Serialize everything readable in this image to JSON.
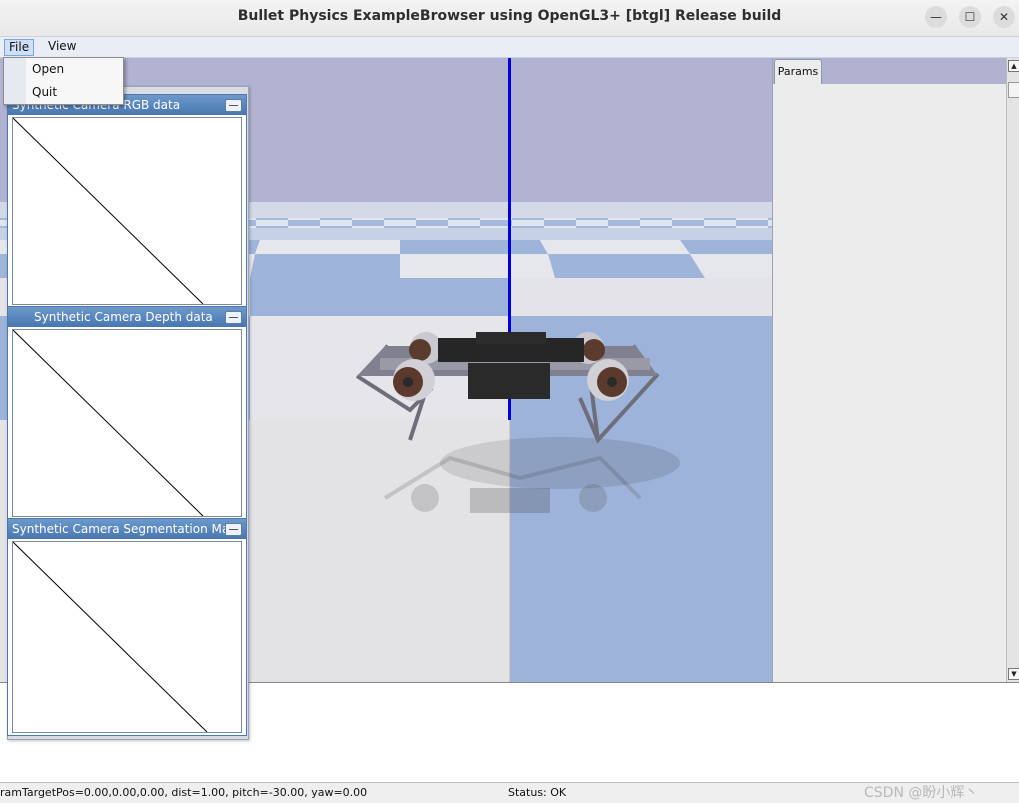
{
  "window": {
    "title": "Bullet Physics ExampleBrowser using OpenGL3+ [btgl] Release build",
    "minimize_glyph": "—",
    "maximize_glyph": "☐",
    "close_glyph": "✕"
  },
  "menubar": {
    "items": [
      {
        "label": "File"
      },
      {
        "label": "View"
      }
    ]
  },
  "file_menu": {
    "items": [
      {
        "label": "Open"
      },
      {
        "label": "Quit"
      }
    ]
  },
  "camera_windows": [
    {
      "title": "Synthetic Camera RGB data"
    },
    {
      "title": "Synthetic Camera Depth data"
    },
    {
      "title": "Synthetic Camera Segmentation Mask"
    }
  ],
  "params": {
    "tab_label": "Params"
  },
  "scrollbar": {
    "up_glyph": "▲",
    "down_glyph": "▼"
  },
  "status": {
    "camera": "ramTargetPos=0.00,0.00,0.00, dist=1.00, pitch=-30.00, yaw=0.00",
    "state": "Status: OK",
    "watermark": "CSDN @盼小辉丶"
  },
  "colors": {
    "sky": "#b2b2d2",
    "floor_blue": "#9bb2d8",
    "floor_light": "#e3e3e3",
    "axis_blue": "#0000e0",
    "titlebar_bg": "#ececec",
    "camera_title_bg": "#5a86bd"
  },
  "icons": {
    "minimize": "minimize-icon",
    "maximize": "maximize-icon",
    "close": "close-icon",
    "camera_minimize": "minimize-icon"
  }
}
